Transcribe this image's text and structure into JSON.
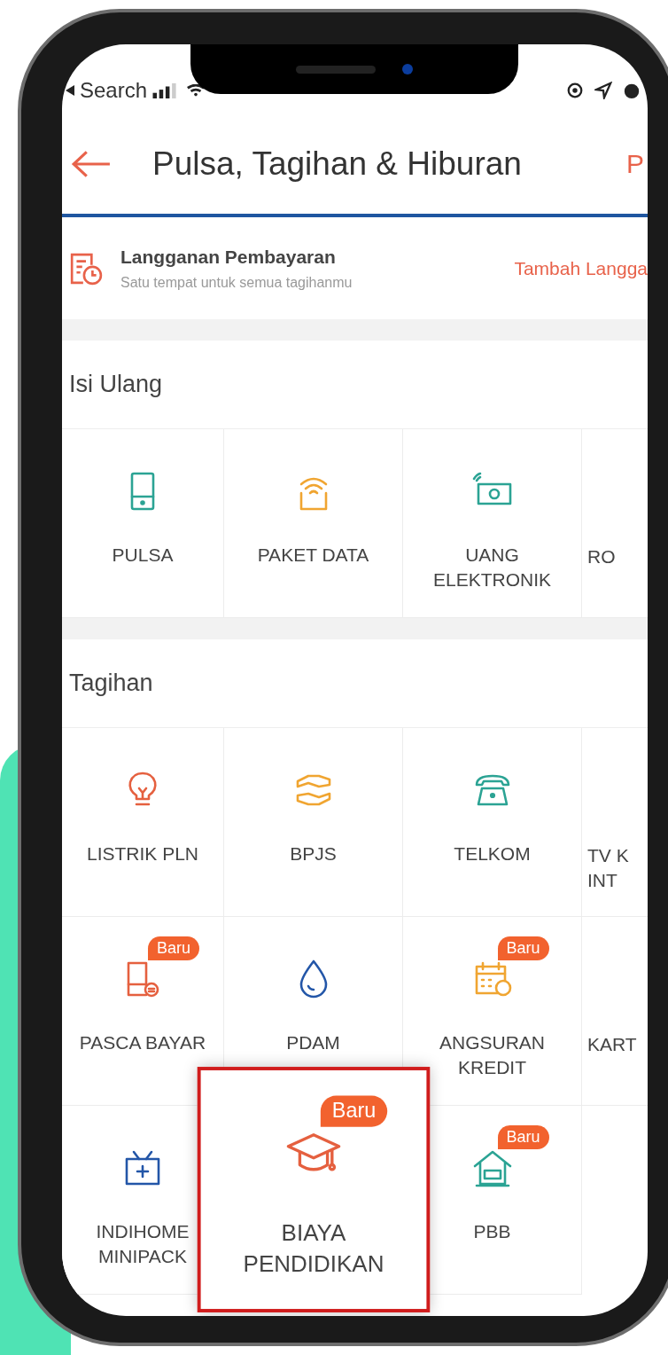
{
  "status_bar": {
    "back_label": "Search"
  },
  "header": {
    "title": "Pulsa, Tagihan & Hiburan",
    "action": "P"
  },
  "subscription": {
    "title": "Langganan Pembayaran",
    "subtitle": "Satu tempat untuk semua tagihanmu",
    "action": "Tambah Langga"
  },
  "sections": [
    {
      "title": "Isi Ulang",
      "items": [
        {
          "kind": "full",
          "label": "PULSA",
          "color": "#2ba394"
        },
        {
          "kind": "full",
          "label": "PAKET DATA",
          "color": "#f0a531"
        },
        {
          "kind": "full",
          "label": "UANG\nELEKTRONIK",
          "color": "#2ba394"
        },
        {
          "kind": "partial",
          "label": "RO"
        }
      ]
    },
    {
      "title": "Tagihan",
      "items": [
        {
          "kind": "full",
          "label": "LISTRIK PLN",
          "color": "#e5603f"
        },
        {
          "kind": "full",
          "label": "BPJS",
          "color": "#f0a531"
        },
        {
          "kind": "full",
          "label": "TELKOM",
          "color": "#2ba394"
        },
        {
          "kind": "partial",
          "label": "TV K\nINT"
        },
        {
          "kind": "full",
          "label": "PASCA BAYAR",
          "color": "#e5603f",
          "badge": "Baru"
        },
        {
          "kind": "full",
          "label": "PDAM",
          "color": "#2356a8"
        },
        {
          "kind": "full",
          "label": "ANGSURAN\nKREDIT",
          "color": "#f0a531",
          "badge": "Baru"
        },
        {
          "kind": "partial",
          "label": "KART"
        },
        {
          "kind": "full",
          "label": "INDIHOME\nMINIPACK",
          "color": "#2356a8"
        },
        {
          "kind": "full",
          "label": "BIAYA\nPENDIDIKAN",
          "color": "#e5603f",
          "badge": "Baru",
          "highlighted": true
        },
        {
          "kind": "full",
          "label": "PBB",
          "color": "#2ba394",
          "badge": "Baru"
        }
      ]
    }
  ]
}
